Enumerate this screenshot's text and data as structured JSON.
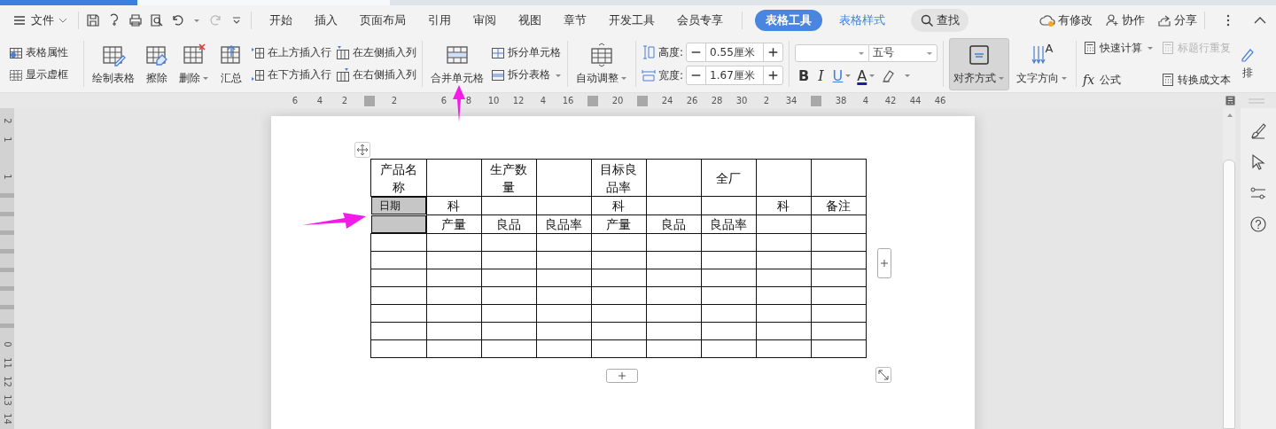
{
  "menu_bar": {
    "file": "文件",
    "tabs": [
      {
        "label": "开始",
        "selected": false,
        "kind": "normal"
      },
      {
        "label": "插入",
        "selected": false,
        "kind": "normal"
      },
      {
        "label": "页面布局",
        "selected": false,
        "kind": "normal"
      },
      {
        "label": "引用",
        "selected": false,
        "kind": "normal"
      },
      {
        "label": "审阅",
        "selected": false,
        "kind": "normal"
      },
      {
        "label": "视图",
        "selected": false,
        "kind": "normal"
      },
      {
        "label": "章节",
        "selected": false,
        "kind": "normal"
      },
      {
        "label": "开发工具",
        "selected": false,
        "kind": "normal"
      },
      {
        "label": "会员专享",
        "selected": false,
        "kind": "normal"
      },
      {
        "label": "表格工具",
        "selected": true,
        "kind": "context"
      },
      {
        "label": "表格样式",
        "selected": false,
        "kind": "context"
      }
    ],
    "search": "查找",
    "actions": [
      "有修改",
      "协作",
      "分享"
    ]
  },
  "ribbon": {
    "table_props": [
      "表格属性",
      "显示虚框"
    ],
    "edit_tools": [
      {
        "label": "绘制表格",
        "dropdown": false
      },
      {
        "label": "擦除",
        "dropdown": false
      },
      {
        "label": "删除",
        "dropdown": true
      },
      {
        "label": "汇总",
        "dropdown": false
      }
    ],
    "insert_rows": [
      "在上方插入行",
      "在下方插入行"
    ],
    "insert_cols": [
      "在左侧插入列",
      "在右侧插入列"
    ],
    "merge": "合并单元格",
    "split": [
      {
        "label": "拆分单元格",
        "dropdown": false
      },
      {
        "label": "拆分表格",
        "dropdown": true
      }
    ],
    "autofit": "自动调整",
    "size_fields": [
      {
        "label": "高度:",
        "value": "0.55厘米"
      },
      {
        "label": "宽度:",
        "value": "1.67厘米"
      }
    ],
    "font": {
      "size": "五号"
    },
    "format_buttons": [
      {
        "glyph": "B",
        "kind": "bold",
        "dropdown": false
      },
      {
        "glyph": "I",
        "kind": "italic",
        "dropdown": false
      },
      {
        "glyph": "U",
        "kind": "underline",
        "dropdown": true
      },
      {
        "glyph": "A",
        "kind": "color",
        "dropdown": true
      }
    ],
    "align": {
      "label": "对齐方式",
      "selected": true
    },
    "text_direction": {
      "label": "文字方向",
      "glyph": "A"
    },
    "calc": [
      {
        "label": "快速计算",
        "disabled": false,
        "dropdown": true
      },
      {
        "label": "标题行重复",
        "disabled": true,
        "dropdown": false
      },
      {
        "label": "公式",
        "disabled": false,
        "dropdown": false,
        "glyph": "fx"
      },
      {
        "label": "转换成文本",
        "disabled": false,
        "dropdown": false
      }
    ],
    "cut_button": "排"
  },
  "ruler": [
    {
      "kind": "num",
      "label": "6"
    },
    {
      "kind": "num",
      "label": "4"
    },
    {
      "kind": "num",
      "label": "2"
    },
    {
      "kind": "block"
    },
    {
      "kind": "num",
      "label": "2"
    },
    {
      "kind": "gap"
    },
    {
      "kind": "num",
      "label": "6"
    },
    {
      "kind": "num",
      "label": "8"
    },
    {
      "kind": "num",
      "label": "10"
    },
    {
      "kind": "num",
      "label": "12"
    },
    {
      "kind": "num",
      "label": "4"
    },
    {
      "kind": "num",
      "label": "16"
    },
    {
      "kind": "block"
    },
    {
      "kind": "num",
      "label": "20"
    },
    {
      "kind": "block"
    },
    {
      "kind": "num",
      "label": "24"
    },
    {
      "kind": "num",
      "label": "26"
    },
    {
      "kind": "num",
      "label": "28"
    },
    {
      "kind": "num",
      "label": "30"
    },
    {
      "kind": "num",
      "label": "2"
    },
    {
      "kind": "num",
      "label": "34"
    },
    {
      "kind": "block"
    },
    {
      "kind": "num",
      "label": "38"
    },
    {
      "kind": "num",
      "label": "4"
    },
    {
      "kind": "num",
      "label": "42"
    },
    {
      "kind": "num",
      "label": "44"
    },
    {
      "kind": "num",
      "label": "46"
    }
  ],
  "vertical_ruler": [
    {
      "kind": "num",
      "label": "2"
    },
    {
      "kind": "num",
      "label": "1"
    },
    {
      "kind": "gap"
    },
    {
      "kind": "num",
      "label": "1"
    },
    {
      "kind": "tick"
    },
    {
      "kind": "tick"
    },
    {
      "kind": "tick"
    },
    {
      "kind": "tick"
    },
    {
      "kind": "tick"
    },
    {
      "kind": "tick"
    },
    {
      "kind": "tick"
    },
    {
      "kind": "tick"
    },
    {
      "kind": "num",
      "label": "0"
    },
    {
      "kind": "num",
      "label": "11"
    },
    {
      "kind": "num",
      "label": "12"
    },
    {
      "kind": "num",
      "label": "13"
    },
    {
      "kind": "num",
      "label": "14"
    }
  ],
  "table": {
    "rows": [
      [
        {
          "text": "产品名称",
          "selected": false
        },
        {
          "selected": false
        },
        {
          "text": "生产数量",
          "selected": false
        },
        {
          "selected": false
        },
        {
          "text": "目标良品率",
          "selected": false
        },
        {
          "selected": false
        },
        {
          "text": "全厂",
          "selected": false
        },
        {
          "selected": false
        },
        {
          "selected": false
        }
      ],
      [
        {
          "text": "日期",
          "selected": true
        },
        {
          "text": "科",
          "selected": false
        },
        {
          "selected": false
        },
        {
          "selected": false
        },
        {
          "text": "科",
          "selected": false
        },
        {
          "selected": false
        },
        {
          "selected": false
        },
        {
          "text": "科",
          "selected": false
        },
        {
          "text": "备注",
          "selected": false
        }
      ],
      [
        {
          "selected": true
        },
        {
          "text": "产量",
          "selected": false
        },
        {
          "text": "良品",
          "selected": false
        },
        {
          "text": "良品率",
          "selected": false
        },
        {
          "text": "产量",
          "selected": false
        },
        {
          "text": "良品",
          "selected": false
        },
        {
          "text": "良品率",
          "selected": false
        },
        {
          "selected": false
        },
        {
          "selected": false
        }
      ],
      [
        {
          "selected": false
        },
        {
          "selected": false
        },
        {
          "selected": false
        },
        {
          "selected": false
        },
        {
          "selected": false
        },
        {
          "selected": false
        },
        {
          "selected": false
        },
        {
          "selected": false
        },
        {
          "selected": false
        }
      ],
      [
        {
          "selected": false
        },
        {
          "selected": false
        },
        {
          "selected": false
        },
        {
          "selected": false
        },
        {
          "selected": false
        },
        {
          "selected": false
        },
        {
          "selected": false
        },
        {
          "selected": false
        },
        {
          "selected": false
        }
      ],
      [
        {
          "selected": false
        },
        {
          "selected": false
        },
        {
          "selected": false
        },
        {
          "selected": false
        },
        {
          "selected": false
        },
        {
          "selected": false
        },
        {
          "selected": false
        },
        {
          "selected": false
        },
        {
          "selected": false
        }
      ],
      [
        {
          "selected": false
        },
        {
          "selected": false
        },
        {
          "selected": false
        },
        {
          "selected": false
        },
        {
          "selected": false
        },
        {
          "selected": false
        },
        {
          "selected": false
        },
        {
          "selected": false
        },
        {
          "selected": false
        }
      ],
      [
        {
          "selected": false
        },
        {
          "selected": false
        },
        {
          "selected": false
        },
        {
          "selected": false
        },
        {
          "selected": false
        },
        {
          "selected": false
        },
        {
          "selected": false
        },
        {
          "selected": false
        },
        {
          "selected": false
        }
      ],
      [
        {
          "selected": false
        },
        {
          "selected": false
        },
        {
          "selected": false
        },
        {
          "selected": false
        },
        {
          "selected": false
        },
        {
          "selected": false
        },
        {
          "selected": false
        },
        {
          "selected": false
        },
        {
          "selected": false
        }
      ],
      [
        {
          "selected": false
        },
        {
          "selected": false
        },
        {
          "selected": false
        },
        {
          "selected": false
        },
        {
          "selected": false
        },
        {
          "selected": false
        },
        {
          "selected": false
        },
        {
          "selected": false
        },
        {
          "selected": false
        }
      ]
    ]
  }
}
